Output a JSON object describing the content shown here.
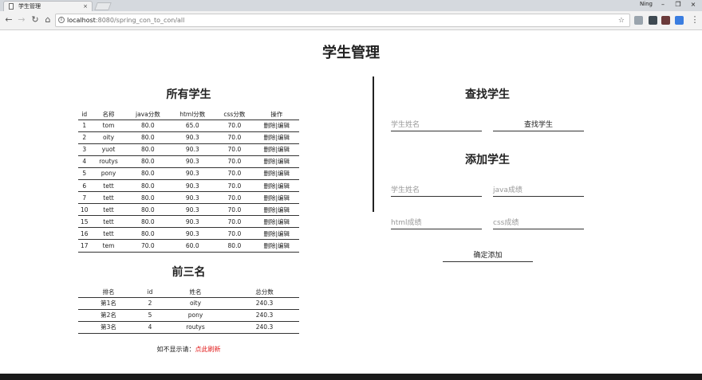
{
  "browser": {
    "tab_title": "学生管理",
    "tab_close": "×",
    "user_name": "Ning",
    "window_controls": [
      "–",
      "❐",
      "×"
    ],
    "url_host": "localhost",
    "url_rest": ":8080/spring_con_to_con/all",
    "nav_icons": [
      "back-icon",
      "forward-icon",
      "reload-icon",
      "home-icon"
    ],
    "extension_colors": [
      "#9aa4ad",
      "#3f4a52",
      "#6b3a3a",
      "#3a6b4a",
      "#3a7de0"
    ]
  },
  "page": {
    "title": "学生管理"
  },
  "all_students": {
    "title": "所有学生",
    "headers": [
      "id",
      "名称",
      "java分数",
      "html分数",
      "css分数",
      "操作"
    ],
    "rows": [
      [
        "1",
        "tom",
        "80.0",
        "65.0",
        "70.0",
        "删除|编辑"
      ],
      [
        "2",
        "oity",
        "80.0",
        "90.3",
        "70.0",
        "删除|编辑"
      ],
      [
        "3",
        "yuot",
        "80.0",
        "90.3",
        "70.0",
        "删除|编辑"
      ],
      [
        "4",
        "routys",
        "80.0",
        "90.3",
        "70.0",
        "删除|编辑"
      ],
      [
        "5",
        "pony",
        "80.0",
        "90.3",
        "70.0",
        "删除|编辑"
      ],
      [
        "6",
        "tett",
        "80.0",
        "90.3",
        "70.0",
        "删除|编辑"
      ],
      [
        "7",
        "tett",
        "80.0",
        "90.3",
        "70.0",
        "删除|编辑"
      ],
      [
        "10",
        "tett",
        "80.0",
        "90.3",
        "70.0",
        "删除|编辑"
      ],
      [
        "15",
        "tett",
        "80.0",
        "90.3",
        "70.0",
        "删除|编辑"
      ],
      [
        "16",
        "tett",
        "80.0",
        "90.3",
        "70.0",
        "删除|编辑"
      ],
      [
        "17",
        "tem",
        "70.0",
        "60.0",
        "80.0",
        "删除|编辑"
      ]
    ]
  },
  "top_three": {
    "title": "前三名",
    "headers": [
      "排名",
      "id",
      "姓名",
      "总分数"
    ],
    "rows": [
      [
        "第1名",
        "2",
        "oity",
        "240.3"
      ],
      [
        "第2名",
        "5",
        "pony",
        "240.3"
      ],
      [
        "第3名",
        "4",
        "routys",
        "240.3"
      ]
    ]
  },
  "refresh": {
    "prompt": "如不显示请：",
    "link": "点此刷新"
  },
  "search": {
    "title": "查找学生",
    "name_placeholder": "学生姓名",
    "button": "查找学生"
  },
  "add": {
    "title": "添加学生",
    "name_placeholder": "学生姓名",
    "java_placeholder": "java成绩",
    "html_placeholder": "html成绩",
    "css_placeholder": "css成绩",
    "button": "确定添加"
  }
}
